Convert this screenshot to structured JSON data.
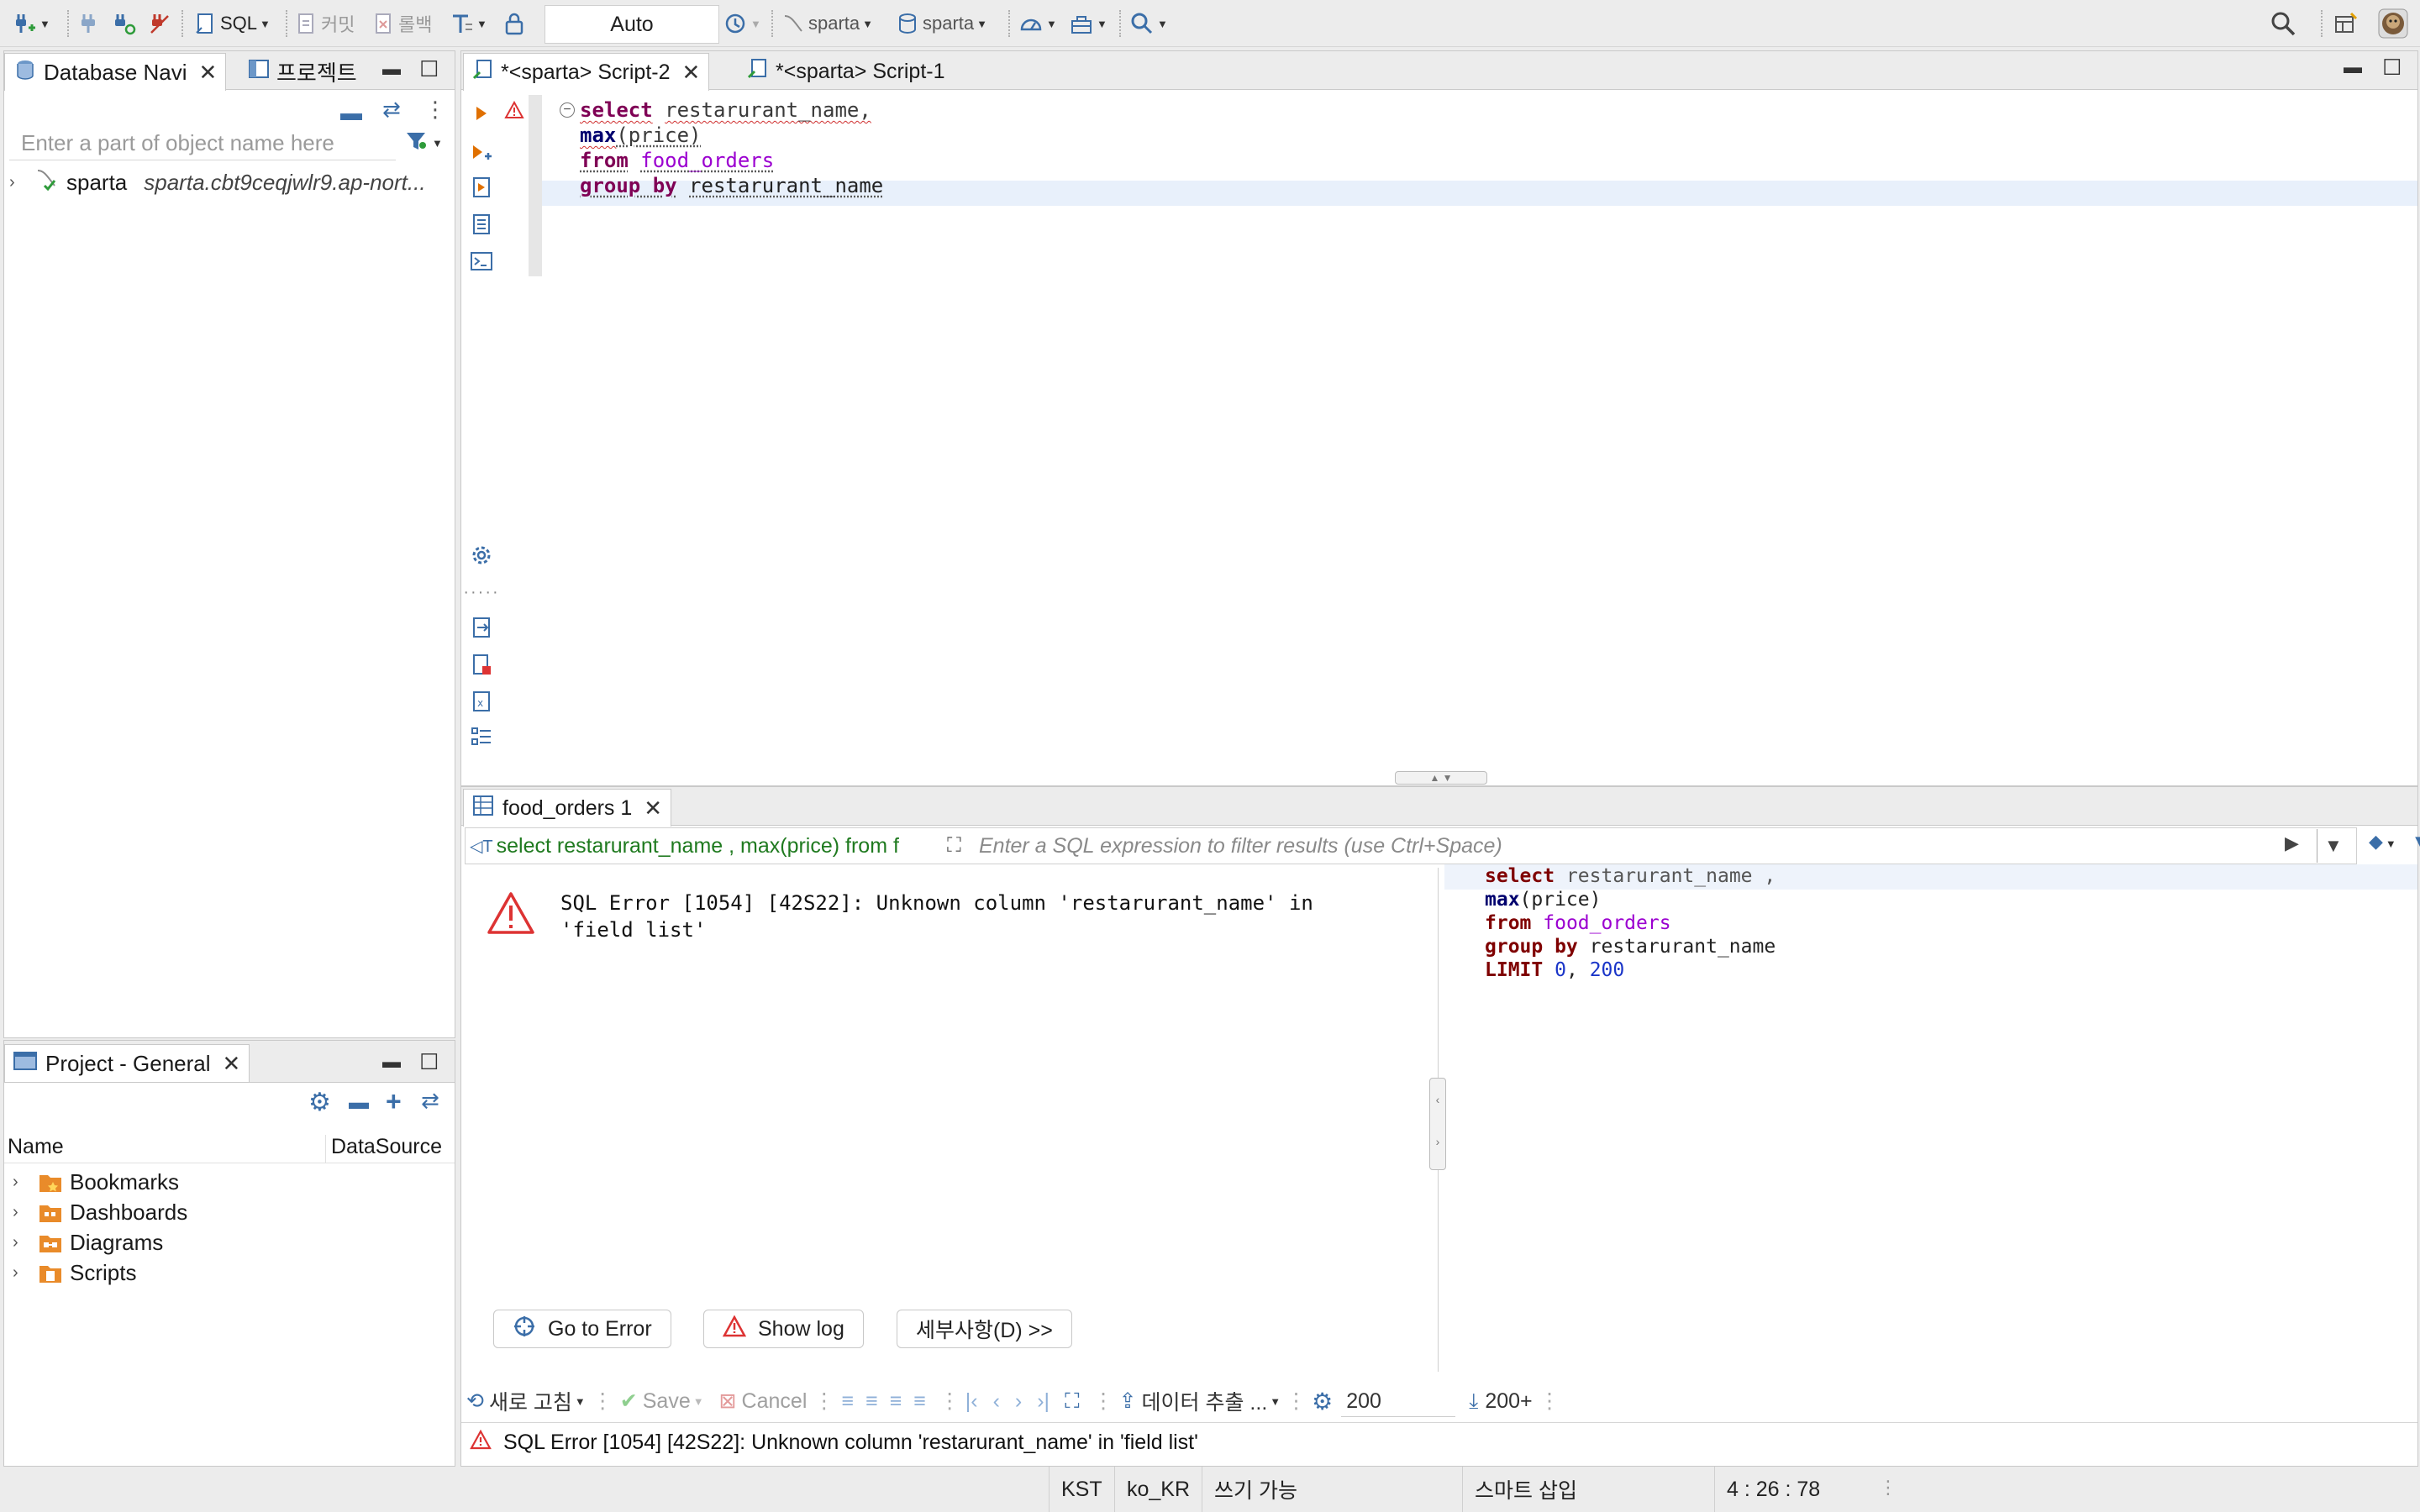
{
  "toolbar": {
    "sql_label": "SQL",
    "commit_label": "커밋",
    "rollback_label": "롤백",
    "tx_mode": "Auto",
    "connection1": "sparta",
    "connection2": "sparta"
  },
  "nav_panel": {
    "tab_db_navigator": "Database Navi",
    "tab_projects": "프로젝트",
    "filter_placeholder": "Enter a part of object name here",
    "connection_name": "sparta",
    "connection_host": "sparta.cbt9ceqjwlr9.ap-nort..."
  },
  "project_panel": {
    "tab_label": "Project - General",
    "col_name": "Name",
    "col_datasource": "DataSource",
    "items": [
      "Bookmarks",
      "Dashboards",
      "Diagrams",
      "Scripts"
    ]
  },
  "editor": {
    "tab_active": "*<sparta> Script-2",
    "tab_other": "*<sparta> Script-1",
    "line1_kw": "select",
    "line1_rest": "restarurant_name,",
    "line2_fn": "max",
    "line2_arg": "(price)",
    "line3_kw": "from",
    "line3_tbl": "food_orders",
    "line4_kw": "group by",
    "line4_col": "restarurant_name"
  },
  "results": {
    "tab_label": "food_orders 1",
    "query_preview": "select restarurant_name , max(price) from f",
    "filter_placeholder": "Enter a SQL expression to filter results (use Ctrl+Space)",
    "error_line1": "SQL Error [1054] [42S22]: Unknown column 'restarurant_name' in",
    "error_line2": "'field list'",
    "sql_lines": {
      "l1_kw": "select",
      "l1_rest": "restarurant_name ,",
      "l2_fn": "max",
      "l2_rest": "(price)",
      "l3_kw": "from",
      "l3_tbl": "food_orders",
      "l4_kw": "group by",
      "l4_rest": "restarurant_name",
      "l5_kw": "LIMIT",
      "l5_a": "0",
      "l5_sep": ",",
      "l5_b": "200"
    },
    "btn_go_to_error": "Go to Error",
    "btn_show_log": "Show log",
    "btn_details": "세부사항(D) >>",
    "bottom": {
      "refresh": "새로 고침",
      "save": "Save",
      "cancel": "Cancel",
      "export": "데이터 추출 ...",
      "fetch_size": "200",
      "fetch_more": "200+"
    },
    "status_error": "SQL Error [1054] [42S22]: Unknown column 'restarurant_name' in 'field list'"
  },
  "statusbar": {
    "timezone": "KST",
    "locale": "ko_KR",
    "writable": "쓰기 가능",
    "insert_mode": "스마트 삽입",
    "cursor": "4 : 26 : 78"
  }
}
